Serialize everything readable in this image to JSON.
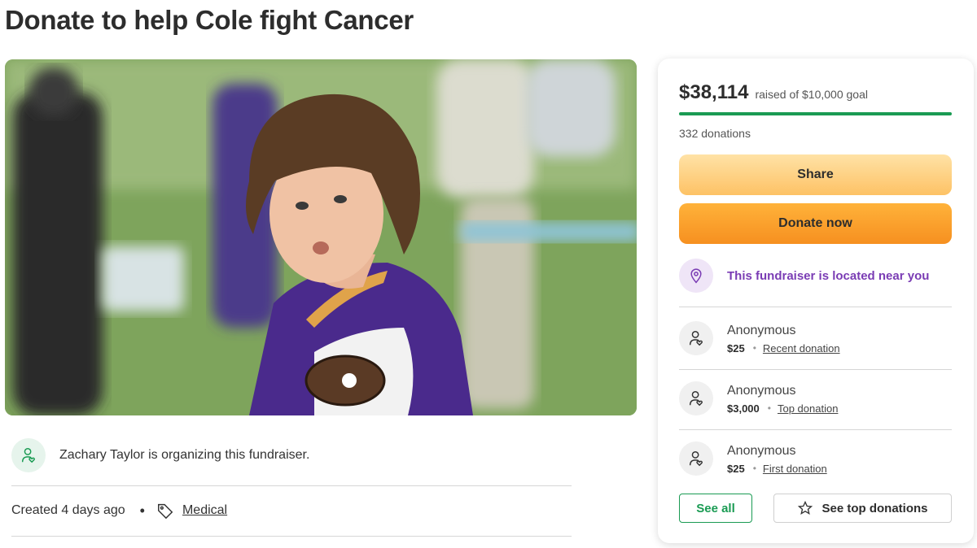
{
  "page": {
    "title": "Donate to help Cole fight Cancer"
  },
  "hero": {
    "icon": "fundraiser-photo"
  },
  "organizer": {
    "text": "Zachary Taylor is organizing this fundraiser.",
    "icon": "user-heart-icon"
  },
  "meta": {
    "created": "Created 4 days ago",
    "dot": "•",
    "category": "Medical",
    "icon": "tag-icon"
  },
  "sidebar": {
    "amount_raised": "$38,114",
    "goal_text": "raised of $10,000 goal",
    "progress_fraction": 1.0,
    "donation_count": "332 donations",
    "share_label": "Share",
    "donate_label": "Donate now",
    "location_text": "This fundraiser is located near you",
    "location_icon": "location-pin-icon",
    "donors": [
      {
        "name": "Anonymous",
        "amount": "$25",
        "type": "Recent donation"
      },
      {
        "name": "Anonymous",
        "amount": "$3,000",
        "type": "Top donation"
      },
      {
        "name": "Anonymous",
        "amount": "$25",
        "type": "First donation"
      }
    ],
    "bullet": "•",
    "see_all_label": "See all",
    "see_top_label": "See top donations",
    "star_icon": "star-icon"
  },
  "colors": {
    "green": "#1a9b53",
    "share": "#fdc265",
    "donate": "#f69020",
    "purple": "#7a3cb4"
  }
}
